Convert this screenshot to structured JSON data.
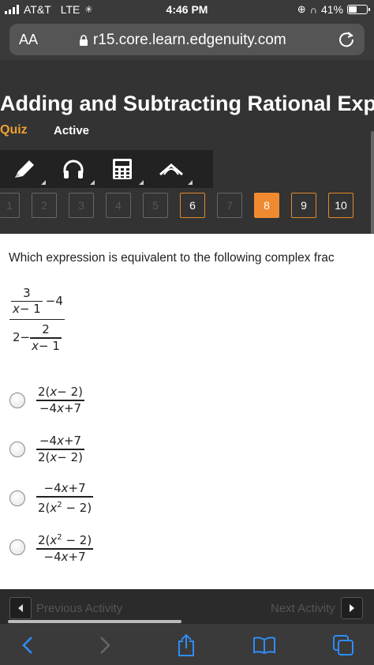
{
  "status": {
    "carrier": "AT&T",
    "network": "LTE",
    "time": "4:46 PM",
    "battery": "41%"
  },
  "browser": {
    "aa_label": "AA",
    "url": "r15.core.learn.edgenuity.com"
  },
  "header": {
    "title": "Adding and Subtracting Rational Exp",
    "quiz_label": "Quiz",
    "status_label": "Active"
  },
  "tools": [
    {
      "icon": "pencil-icon"
    },
    {
      "icon": "headphones-icon"
    },
    {
      "icon": "calculator-icon"
    },
    {
      "icon": "reference-icon"
    }
  ],
  "question_nav": [
    "1",
    "2",
    "3",
    "4",
    "5",
    "6",
    "7",
    "8",
    "9",
    "10"
  ],
  "question_nav_state": {
    "open": [
      "6",
      "9",
      "10"
    ],
    "current": "8"
  },
  "question": {
    "prompt": "Which expression is equivalent to the following complex frac",
    "expression": {
      "top_num": "3",
      "top_den": "x− 1",
      "top_tail": "−4",
      "bottom_lead": "2−",
      "bottom_num": "2",
      "bottom_den": "x− 1"
    }
  },
  "choices": [
    {
      "num": "2(x− 2)",
      "den": "−4x+7"
    },
    {
      "num": "−4x+7",
      "den": "2(x− 2)"
    },
    {
      "num": "−4x+7",
      "den": "2(x2 − 2)"
    },
    {
      "num": "2(x2 − 2)",
      "den": "−4x+7"
    }
  ],
  "activity_nav": {
    "previous": "Previous Activity",
    "next": "Next Activity"
  },
  "colors": {
    "accent": "#f08a30",
    "link_blue": "#2f8cf6"
  }
}
